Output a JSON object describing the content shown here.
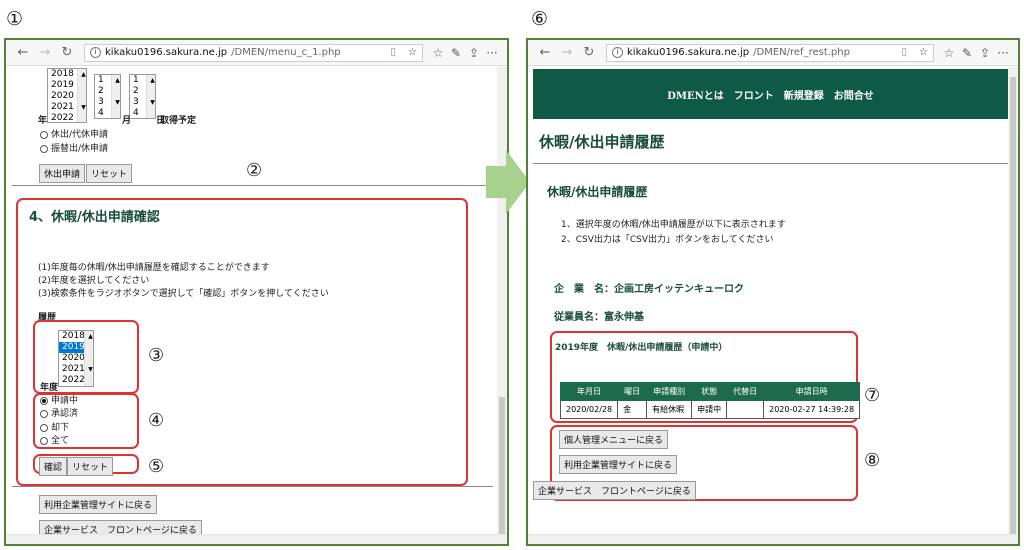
{
  "markers": [
    "①",
    "②",
    "③",
    "④",
    "⑤",
    "⑥",
    "⑦",
    "⑧"
  ],
  "left": {
    "url_host": "kikaku0196.sakura.ne.jp",
    "url_path": "/DMEN/menu_c_1.php",
    "year_list": [
      "2018",
      "2019",
      "2020",
      "2021",
      "2022"
    ],
    "year_label": "年",
    "month_list": [
      "1",
      "2",
      "3",
      "4"
    ],
    "month_label": "月",
    "day_list": [
      "1",
      "2",
      "3",
      "4"
    ],
    "day_label": "日",
    "acquire_label": "取得予定",
    "radio_kyushutsu": "休出/代休申請",
    "radio_furikae": "振替出/休申請",
    "btn_apply": "休出申請",
    "btn_reset": "リセット",
    "section_title": "4、休暇/休出申請確認",
    "notes": [
      "(1)年度毎の休暇/休出申請履歴を確認することができます",
      "(2)年度を選択してください",
      "(3)検索条件をラジオボタンで選択して「確認」ボタンを押してください"
    ],
    "history_label": "履歴",
    "history_years": [
      "2018",
      "2019",
      "2020",
      "2021",
      "2022"
    ],
    "history_selected": "2019",
    "nendo_label": "年度",
    "status_options": [
      "申請中",
      "承認済",
      "却下",
      "全て"
    ],
    "btn_confirm": "確認",
    "btn_reset2": "リセット",
    "btn_back_mgmt": "利用企業管理サイトに戻る",
    "btn_back_front": "企業サービス　フロントページに戻る"
  },
  "right": {
    "url_host": "kikaku0196.sakura.ne.jp",
    "url_path": "/DMEN/ref_rest.php",
    "nav_items": [
      "DMENとは",
      "フロント",
      "新規登録",
      "お問合せ"
    ],
    "page_title": "休暇/休出申請履歴",
    "sub_title": "休暇/休出申請履歴",
    "notes": [
      "1、選択年度の休暇/休出申請履歴が以下に表示されます",
      "2、CSV出力は「CSV出力」ボタンをおしてください"
    ],
    "company_label": "企　業　名：企画工房イッテンキューロク",
    "employee_label": "従業員名：富永伸基",
    "history_heading": "2019年度　休暇/休出申請履歴（申請中）",
    "table_headers": [
      "年月日",
      "曜日",
      "申請種別",
      "状態",
      "代替日",
      "申請日時"
    ],
    "table_rows": [
      [
        "2020/02/28",
        "金",
        "有給休暇",
        "申請中",
        "",
        "2020-02-27 14:39:28"
      ]
    ],
    "btn_back_personal": "個人管理メニューに戻る",
    "btn_back_mgmt": "利用企業管理サイトに戻る",
    "btn_back_front": "企業サービス　フロントページに戻る"
  },
  "colors": {
    "frame": "#548235",
    "header_green": "#0e5a45",
    "table_header": "#1d6b4f",
    "highlight": "#d33",
    "arrow": "#a9d18e"
  }
}
